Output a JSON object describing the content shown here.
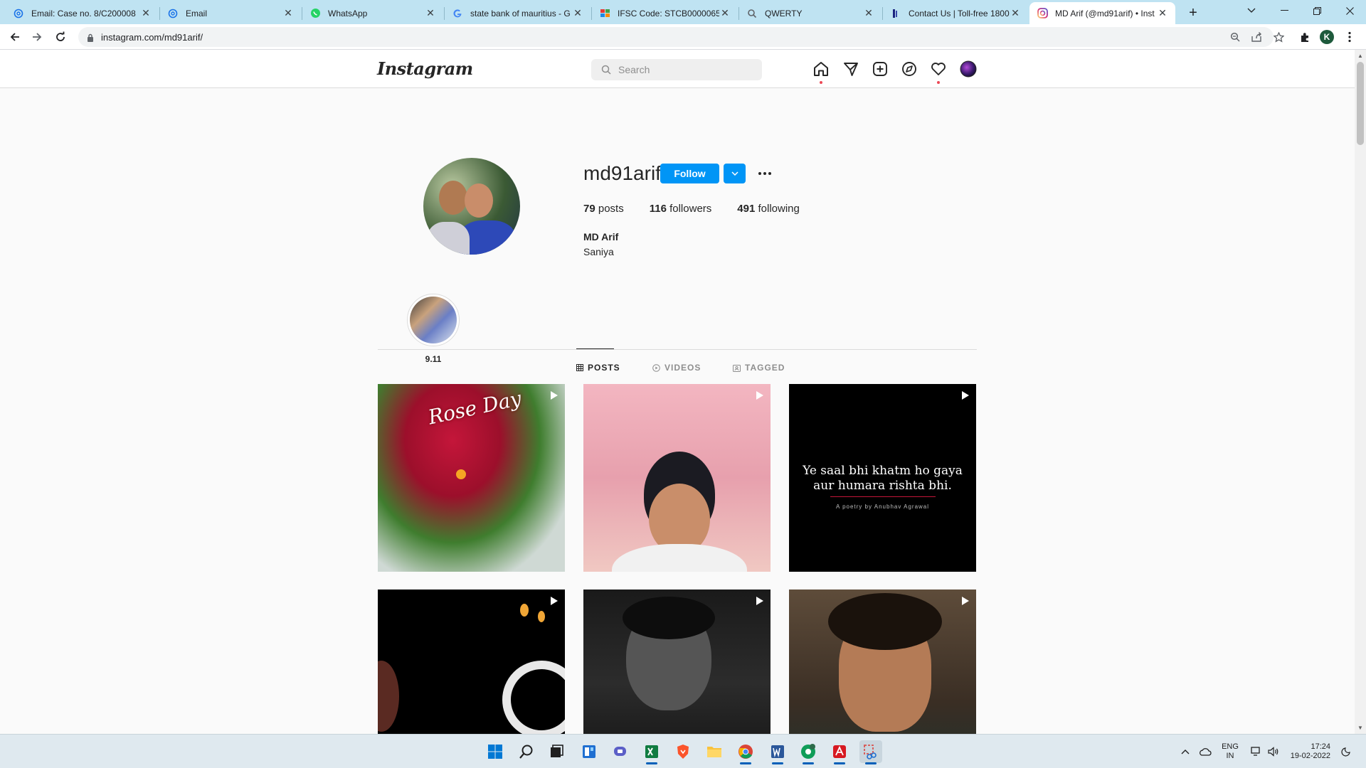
{
  "browser": {
    "tabs": [
      {
        "title": "Email: Case no. 8/C200008",
        "icon": "at-icon"
      },
      {
        "title": "Email",
        "icon": "at-icon"
      },
      {
        "title": "WhatsApp",
        "icon": "whatsapp-icon"
      },
      {
        "title": "state bank of mauritius - G",
        "icon": "google-icon"
      },
      {
        "title": "IFSC Code: STCB0000065, ",
        "icon": "ifsc-icon"
      },
      {
        "title": "QWERTY",
        "icon": "search-icon"
      },
      {
        "title": "Contact Us | Toll-free 1800",
        "icon": "bank-icon"
      },
      {
        "title": "MD Arif (@md91arif) • Inst",
        "icon": "instagram-icon",
        "active": true
      }
    ],
    "url": "instagram.com/md91arif/",
    "profile_initial": "K"
  },
  "ig": {
    "logo": "Instagram",
    "search_placeholder": "Search",
    "profile": {
      "username": "md91arif",
      "follow_label": "Follow",
      "posts_count": "79",
      "posts_label": "posts",
      "followers_count": "116",
      "followers_label": "followers",
      "following_count": "491",
      "following_label": "following",
      "full_name": "MD Arif",
      "bio": "Saniya"
    },
    "highlights": [
      {
        "label": "9.11"
      }
    ],
    "tabs": [
      {
        "label": "POSTS",
        "active": true
      },
      {
        "label": "VIDEOS",
        "active": false
      },
      {
        "label": "TAGGED",
        "active": false
      }
    ],
    "posts": [
      {
        "type": "reel",
        "text": "Rose Day"
      },
      {
        "type": "reel",
        "text": ""
      },
      {
        "type": "reel",
        "text": "Ye saal bhi khatm ho gaya aur humara rishta bhi.",
        "line1": "Ye saal bhi khatm ho gaya",
        "line2": "aur humara rishta bhi.",
        "credit": "A poetry by Anubhav Agrawal"
      },
      {
        "type": "reel",
        "text": ""
      },
      {
        "type": "reel",
        "text": ""
      },
      {
        "type": "reel",
        "text": ""
      }
    ]
  },
  "taskbar": {
    "lang": "ENG",
    "region": "IN",
    "time": "17:24",
    "date": "19-02-2022"
  },
  "colors": {
    "follow_blue": "#0095f6",
    "tabstrip": "#bfe3f2",
    "notification_red": "#ed4956"
  }
}
